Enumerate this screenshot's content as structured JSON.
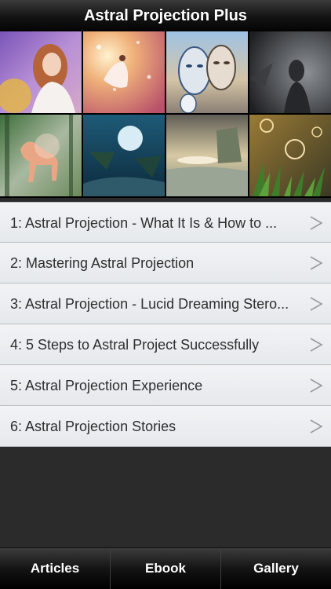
{
  "header": {
    "title": "Astral Projection Plus"
  },
  "gallery": {
    "thumbnails": [
      {
        "name": "girl-with-flower-thumbnail"
      },
      {
        "name": "woman-in-light-thumbnail"
      },
      {
        "name": "faces-art-thumbnail"
      },
      {
        "name": "dark-figure-thumbnail"
      },
      {
        "name": "spirit-horse-thumbnail"
      },
      {
        "name": "floating-islands-thumbnail"
      },
      {
        "name": "misty-landscape-thumbnail"
      },
      {
        "name": "bubbles-in-grass-thumbnail"
      }
    ]
  },
  "articles": {
    "items": [
      {
        "label": "1: Astral Projection - What It Is & How to ..."
      },
      {
        "label": "2: Mastering Astral Projection"
      },
      {
        "label": "3: Astral Projection - Lucid Dreaming Stero..."
      },
      {
        "label": "4: 5 Steps to Astral Project Successfully"
      },
      {
        "label": "5: Astral Projection Experience"
      },
      {
        "label": "6: Astral Projection Stories"
      }
    ],
    "chevron": ">"
  },
  "tabs": {
    "articles": "Articles",
    "ebook": "Ebook",
    "gallery": "Gallery"
  },
  "colors": {
    "nav_bar": "#141414",
    "list_background": "#e9ecef",
    "row_text": "#2e2e2e",
    "chevron": "#9a9a9a",
    "tab_text": "#ffffff"
  }
}
